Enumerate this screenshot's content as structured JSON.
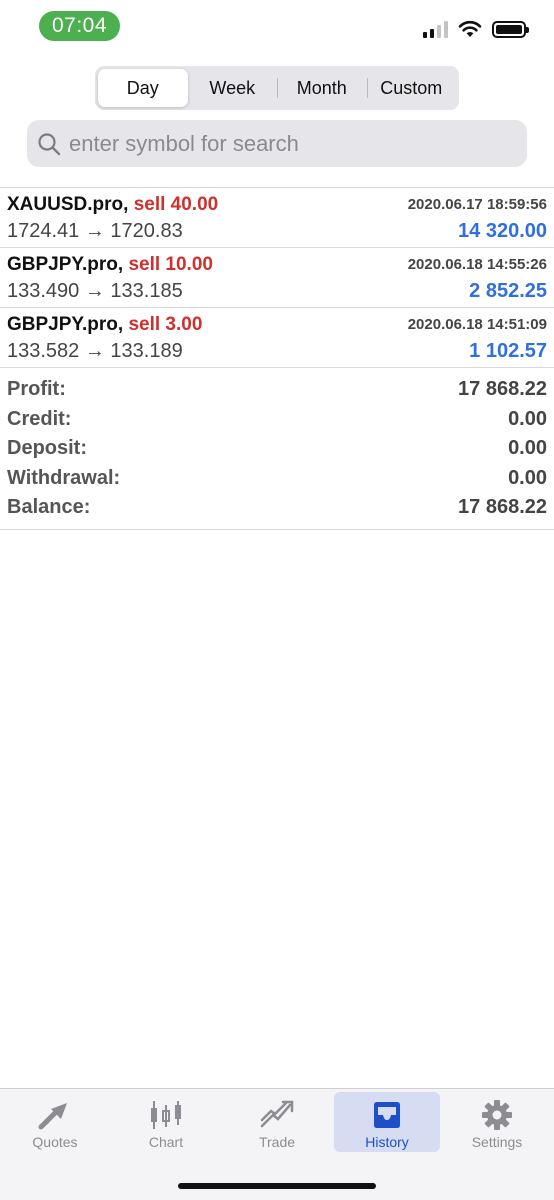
{
  "status_bar": {
    "time": "07:04"
  },
  "period_tabs": [
    "Day",
    "Week",
    "Month",
    "Custom"
  ],
  "selected_period": "Day",
  "search": {
    "placeholder": "enter symbol for search"
  },
  "deals": [
    {
      "symbol": "XAUUSD.pro,",
      "side": "sell 40.00",
      "prices": "1724.41 → 1720.83",
      "time": "2020.06.17 18:59:56",
      "profit": "14 320.00"
    },
    {
      "symbol": "GBPJPY.pro,",
      "side": "sell 10.00",
      "prices": "133.490 → 133.185",
      "time": "2020.06.18 14:55:26",
      "profit": "2 852.25"
    },
    {
      "symbol": "GBPJPY.pro,",
      "side": "sell 3.00",
      "prices": "133.582 → 133.189",
      "time": "2020.06.18 14:51:09",
      "profit": "1 102.57"
    }
  ],
  "summary": [
    {
      "label": "Profit:",
      "value": "17 868.22"
    },
    {
      "label": "Credit:",
      "value": "0.00"
    },
    {
      "label": "Deposit:",
      "value": "0.00"
    },
    {
      "label": "Withdrawal:",
      "value": "0.00"
    },
    {
      "label": "Balance:",
      "value": "17 868.22"
    }
  ],
  "tab_bar": [
    {
      "label": "Quotes",
      "icon": "quotes-arrows-icon"
    },
    {
      "label": "Chart",
      "icon": "candlestick-chart-icon"
    },
    {
      "label": "Trade",
      "icon": "trade-trend-icon"
    },
    {
      "label": "History",
      "icon": "inbox-tray-icon"
    },
    {
      "label": "Settings",
      "icon": "gear-icon"
    }
  ],
  "active_tab": "History",
  "colors": {
    "sell": "#d0302d",
    "profit": "#2f6fe0",
    "active_tab": "#1f4fc8",
    "time_pill": "#4caf50"
  }
}
